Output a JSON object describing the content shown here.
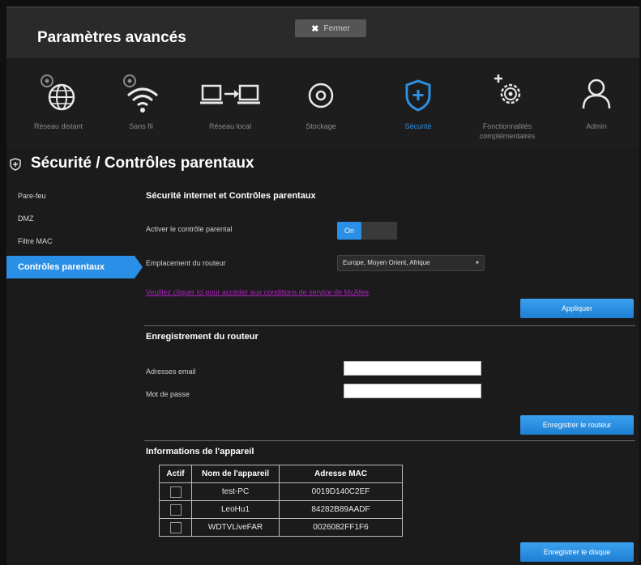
{
  "app": {
    "title": "Paramètres avancés",
    "close_label": "Fermer",
    "close_glyph": "✖"
  },
  "nav": {
    "items": [
      {
        "label": "Réseau distant",
        "icon": "globe-gear-icon",
        "active": false
      },
      {
        "label": "Sans fil",
        "icon": "wifi-gear-icon",
        "active": false
      },
      {
        "label": "Réseau local",
        "icon": "lan-computers-icon",
        "active": false
      },
      {
        "label": "Stockage",
        "icon": "storage-disk-icon",
        "active": false
      },
      {
        "label": "Sécurité",
        "icon": "shield-plus-icon",
        "active": true
      },
      {
        "label": "Fonctionnalités complémentaires",
        "icon": "gear-plus-icon",
        "active": false
      },
      {
        "label": "Admin",
        "icon": "user-icon",
        "active": false
      }
    ]
  },
  "page": {
    "title": "Sécurité / Contrôles parentaux"
  },
  "sidebar": {
    "items": [
      {
        "label": "Pare-feu",
        "active": false
      },
      {
        "label": "DMZ",
        "active": false
      },
      {
        "label": "Filtre MAC",
        "active": false
      },
      {
        "label": "Contrôles parentaux",
        "active": true
      }
    ]
  },
  "parental": {
    "section_title": "Sécurité internet et Contrôles parentaux",
    "enable_label": "Activer le contrôle parental",
    "toggle_on_label": "On",
    "location_label": "Emplacement du routeur",
    "location_value": "Europe, Moyen Orient, Afrique",
    "link_text": "Veuillez cliquer ici pour accéder aux conditions de service de McAfee",
    "apply_label": "Appliquer"
  },
  "registration": {
    "section_title": "Enregistrement du routeur",
    "email_label": "Adresses email",
    "email_value": "",
    "password_label": "Mot de passe",
    "password_value": "",
    "register_label": "Enregistrer le routeur"
  },
  "devices": {
    "section_title": "Informations de l'appareil",
    "columns": [
      "Actif",
      "Nom de l'appareil",
      "Adresse MAC"
    ],
    "rows": [
      {
        "active": false,
        "name": "test-PC",
        "mac": "0019D140C2EF"
      },
      {
        "active": false,
        "name": "LeoHu1",
        "mac": "84282B89AADF"
      },
      {
        "active": false,
        "name": "WDTVLiveFAR",
        "mac": "0026082FF1F6"
      }
    ],
    "save_label": "Enregistrer le disque"
  },
  "colors": {
    "accent": "#2a8fe6",
    "background": "#1b1b1b",
    "link": "#b020c0"
  }
}
